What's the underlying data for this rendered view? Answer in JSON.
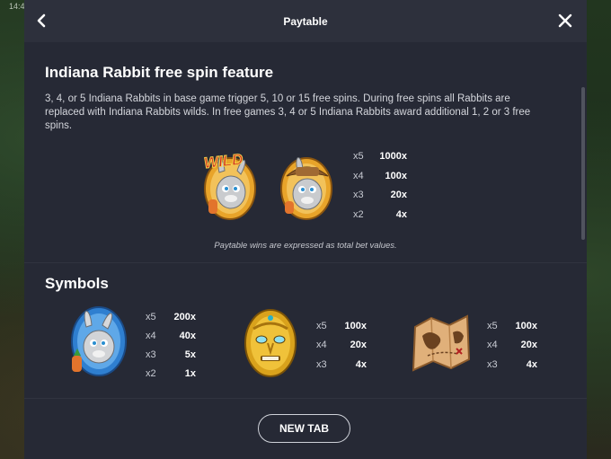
{
  "status_bar": {
    "time": "14:4"
  },
  "header": {
    "title": "Paytable"
  },
  "feature": {
    "heading": "Indiana Rabbit free spin feature",
    "description": "3, 4, or 5 Indiana Rabbits in base game trigger 5, 10 or 15 free spins. During free spins all Rabbits are replaced with Indiana Rabbits wilds. In free games 3, 4 or 5 Indiana Rabbits award additional 1, 2 or 3 free spins.",
    "wild_badge_text": "WILD",
    "payouts": [
      {
        "count": "x5",
        "value": "1000x"
      },
      {
        "count": "x4",
        "value": "100x"
      },
      {
        "count": "x3",
        "value": "20x"
      },
      {
        "count": "x2",
        "value": "4x"
      }
    ],
    "note": "Paytable wins are expressed as total bet values."
  },
  "symbols": {
    "heading": "Symbols",
    "items": [
      {
        "icon": "rabbit-blue-egg-icon",
        "payouts": [
          {
            "count": "x5",
            "value": "200x"
          },
          {
            "count": "x4",
            "value": "40x"
          },
          {
            "count": "x3",
            "value": "5x"
          },
          {
            "count": "x2",
            "value": "1x"
          }
        ]
      },
      {
        "icon": "golden-mask-icon",
        "payouts": [
          {
            "count": "x5",
            "value": "100x"
          },
          {
            "count": "x4",
            "value": "20x"
          },
          {
            "count": "x3",
            "value": "4x"
          }
        ]
      },
      {
        "icon": "treasure-map-icon",
        "payouts": [
          {
            "count": "x5",
            "value": "100x"
          },
          {
            "count": "x4",
            "value": "20x"
          },
          {
            "count": "x3",
            "value": "4x"
          }
        ]
      }
    ]
  },
  "footer": {
    "new_tab_label": "NEW TAB"
  },
  "colors": {
    "panel": "#262935",
    "header": "#2d303c",
    "text": "#ffffff",
    "gold": "#e8a42a"
  }
}
